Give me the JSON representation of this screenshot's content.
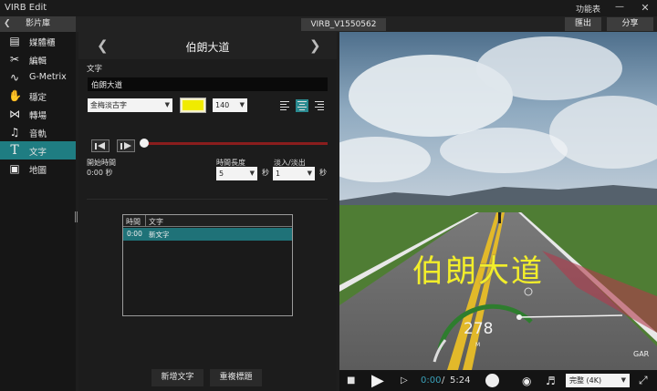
{
  "app": {
    "title": "VIRB Edit",
    "menu": "功能表"
  },
  "toolbar": {
    "library": "影片庫",
    "file_name": "VIRB_V1550562",
    "export": "匯出",
    "share": "分享"
  },
  "sidebar": {
    "items": [
      {
        "label": "媒體櫃",
        "icon": "film-icon"
      },
      {
        "label": "編輯",
        "icon": "scissors-icon"
      },
      {
        "label": "G-Metrix",
        "icon": "g-metrix-icon"
      },
      {
        "label": "穩定",
        "icon": "stabilize-icon"
      },
      {
        "label": "轉場",
        "icon": "transition-icon"
      },
      {
        "label": "音軌",
        "icon": "music-icon"
      },
      {
        "label": "文字",
        "icon": "text-icon",
        "active": true
      },
      {
        "label": "地圖",
        "icon": "map-icon"
      }
    ]
  },
  "panel": {
    "title": "伯朗大道",
    "text_label": "文字",
    "text_value": "伯朗大道",
    "font": "金梅淡古字",
    "text_color": "#f0eb00",
    "font_size": "140",
    "start_label": "開始時間",
    "start_value": "0:00 秒",
    "duration_label": "時間長度",
    "duration_value": "5",
    "duration_unit": "秒",
    "fade_label": "淡入/淡出",
    "fade_value": "1",
    "fade_unit": "秒",
    "table": {
      "headers": [
        "時間",
        "文字"
      ],
      "rows": [
        {
          "time": "0:00",
          "text": "新文字"
        }
      ]
    },
    "add_text": "新增文字",
    "reset_title": "重複標題"
  },
  "video": {
    "overlay_text": "伯朗大道",
    "speed": "278",
    "speed_unit": "M",
    "gauge_label": "GAR"
  },
  "player": {
    "current_time": "0:00",
    "separator": "/",
    "duration": "5:24",
    "quality": "完整 (4K)"
  },
  "colors": {
    "accent": "#1f7d82",
    "timeline": "#8a1d1d",
    "overlay": "#f2ee2a"
  }
}
